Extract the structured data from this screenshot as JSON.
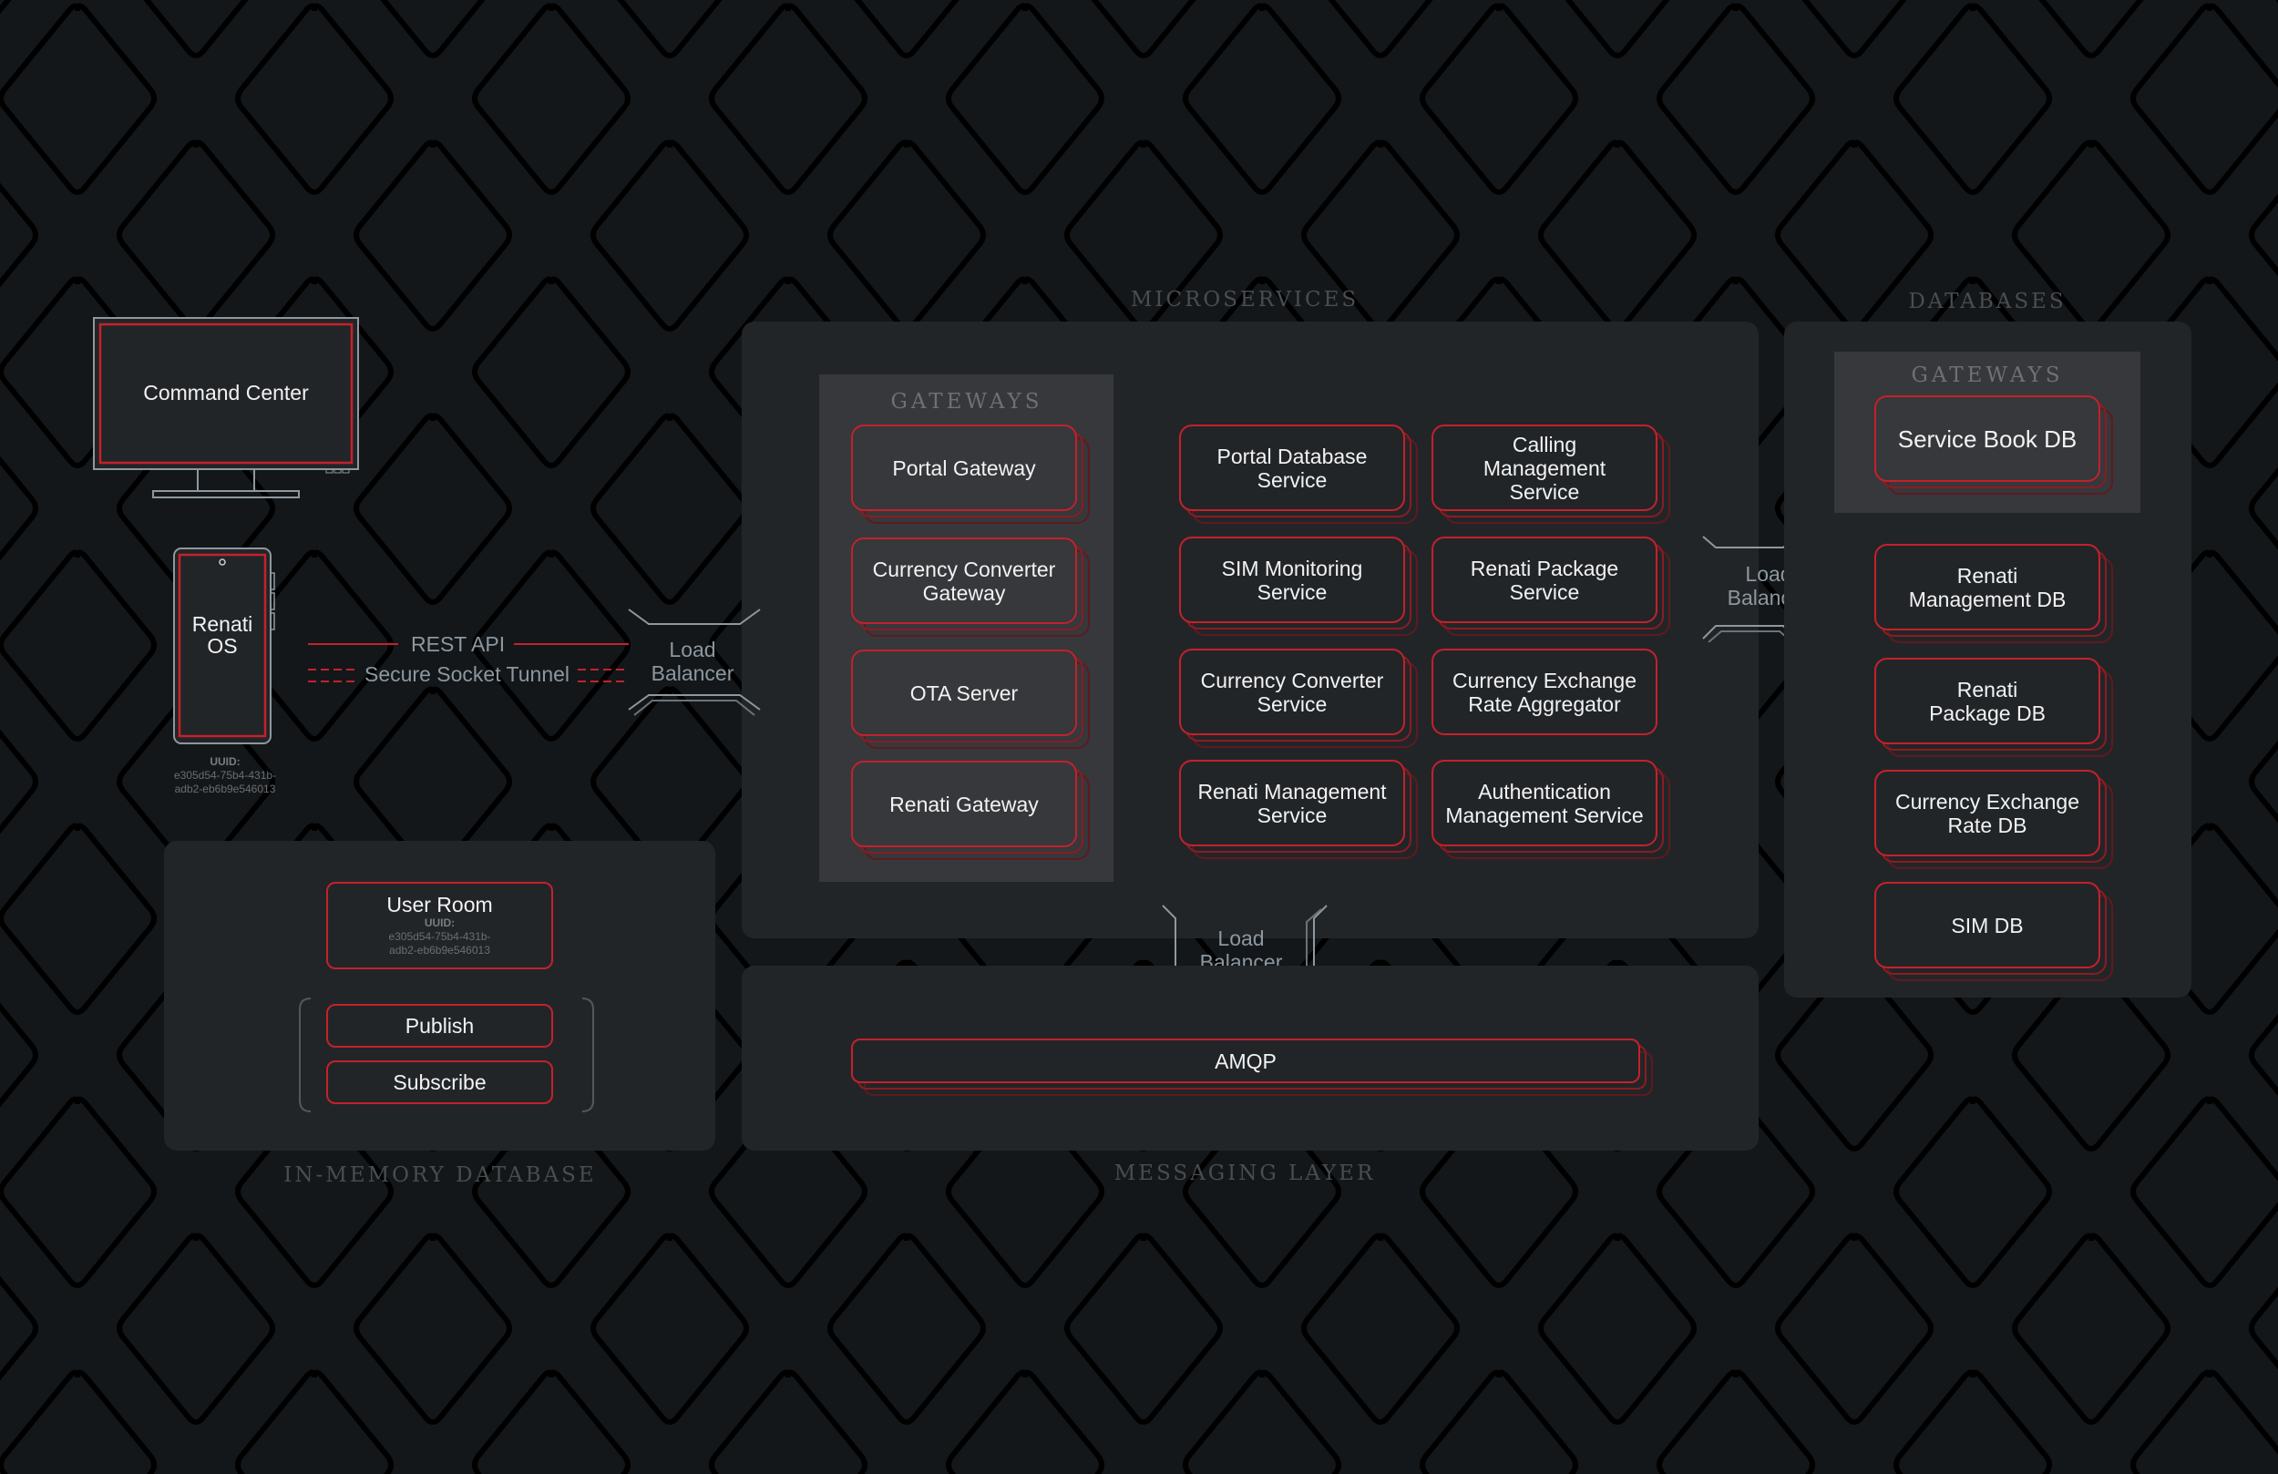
{
  "colors": {
    "background": "#13171a",
    "panel": "#222528",
    "subpanel": "#36383b",
    "accent_red": "#c4212b",
    "muted_text": "#8c979f",
    "section_label": "#4a4d50"
  },
  "clients": {
    "command_center": {
      "label": "Command Center",
      "icon": "monitor-icon"
    },
    "renati_os": {
      "label_line1": "Renati",
      "label_line2": "OS",
      "icon": "smartphone-icon",
      "uuid_label": "UUID:",
      "uuid_line1": "e305d54-75b4-431b-",
      "uuid_line2": "adb2-eb6b9e546013"
    }
  },
  "connections": {
    "rest_api": "REST API",
    "secure_socket_tunnel": "Secure Socket Tunnel"
  },
  "load_balancers": {
    "client_to_micro": {
      "line1": "Load",
      "line2": "Balancer"
    },
    "micro_to_db": {
      "line1": "Load",
      "line2": "Balancer"
    },
    "micro_to_messaging": {
      "line1": "Load",
      "line2": "Balancer"
    }
  },
  "microservices": {
    "title": "MICROSERVICES",
    "gateways": {
      "title": "GATEWAYS",
      "items": [
        {
          "label": "Portal Gateway"
        },
        {
          "label": "Currency Converter Gateway"
        },
        {
          "label": "OTA Server"
        },
        {
          "label": "Renati Gateway"
        }
      ]
    },
    "services": [
      {
        "label": "Portal Database Service",
        "stacked": true
      },
      {
        "label": "Calling Management Service",
        "stacked": true
      },
      {
        "label": "SIM Monitoring Service",
        "stacked": true
      },
      {
        "label": "Renati Package Service",
        "stacked": true
      },
      {
        "label": "Currency Converter Service",
        "stacked": true
      },
      {
        "label": "Currency Exchange Rate Aggregator",
        "stacked": false
      },
      {
        "label": "Renati Management Service",
        "stacked": true
      },
      {
        "label": "Authentication Management Service",
        "stacked": true
      }
    ]
  },
  "databases": {
    "title": "DATABASES",
    "gateways": {
      "title": "GATEWAYS",
      "items": [
        {
          "label": "Service Book DB"
        }
      ]
    },
    "items": [
      {
        "label": "Renati Management DB"
      },
      {
        "label": "Renati Package DB"
      },
      {
        "label": "Currency Exchange Rate DB"
      },
      {
        "label": "SIM DB"
      }
    ]
  },
  "messaging_layer": {
    "title": "MESSAGING LAYER",
    "items": [
      {
        "label": "AMQP"
      }
    ]
  },
  "in_memory_database": {
    "title": "IN-MEMORY DATABASE",
    "user_room": {
      "label": "User Room",
      "uuid_label": "UUID:",
      "uuid_line1": "e305d54-75b4-431b-",
      "uuid_line2": "adb2-eb6b9e546013"
    },
    "actions": [
      {
        "label": "Publish"
      },
      {
        "label": "Subscribe"
      }
    ]
  }
}
